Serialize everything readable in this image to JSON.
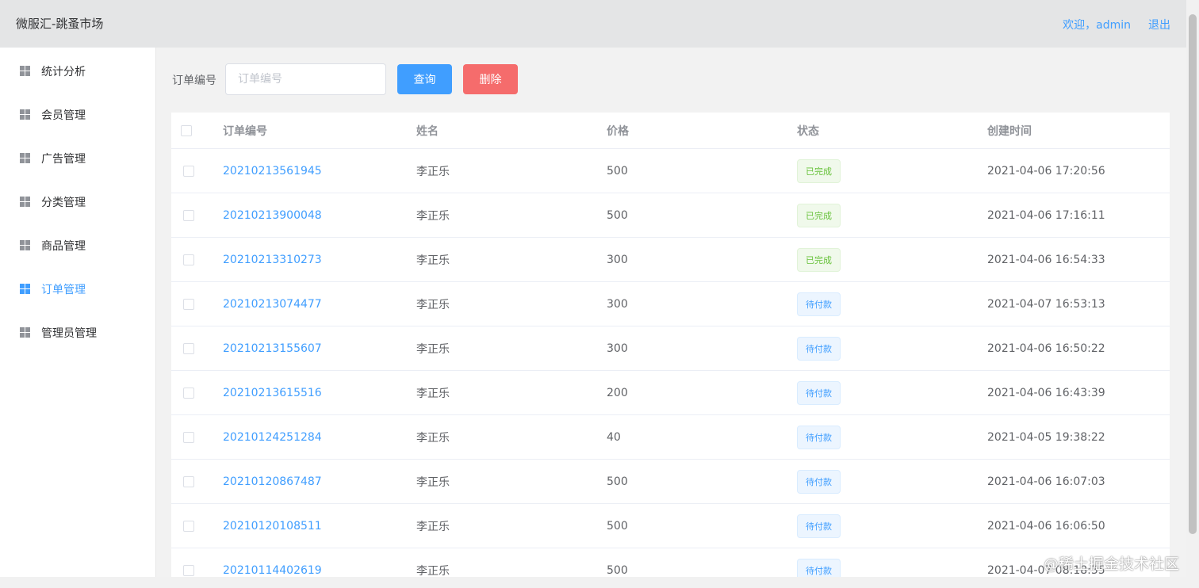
{
  "header": {
    "title": "微服汇-跳蚤市场",
    "welcome": "欢迎，admin",
    "logout": "退出"
  },
  "sidebar": {
    "items": [
      {
        "label": "统计分析",
        "icon": "grid-icon"
      },
      {
        "label": "会员管理",
        "icon": "grid-icon"
      },
      {
        "label": "广告管理",
        "icon": "grid-icon"
      },
      {
        "label": "分类管理",
        "icon": "grid-icon"
      },
      {
        "label": "商品管理",
        "icon": "grid-icon"
      },
      {
        "label": "订单管理",
        "icon": "grid-icon",
        "active": true
      },
      {
        "label": "管理员管理",
        "icon": "grid-icon"
      }
    ]
  },
  "search": {
    "label": "订单编号",
    "placeholder": "订单编号",
    "value": "",
    "query_button": "查询",
    "delete_button": "删除"
  },
  "table": {
    "headers": [
      "订单编号",
      "姓名",
      "价格",
      "状态",
      "创建时间"
    ],
    "rows": [
      {
        "order_no": "20210213561945",
        "name": "李正乐",
        "price": "500",
        "status": "已完成",
        "created": "2021-04-06 17:20:56"
      },
      {
        "order_no": "20210213900048",
        "name": "李正乐",
        "price": "500",
        "status": "已完成",
        "created": "2021-04-06 17:16:11"
      },
      {
        "order_no": "20210213310273",
        "name": "李正乐",
        "price": "300",
        "status": "已完成",
        "created": "2021-04-06 16:54:33"
      },
      {
        "order_no": "20210213074477",
        "name": "李正乐",
        "price": "300",
        "status": "待付款",
        "created": "2021-04-07 16:53:13"
      },
      {
        "order_no": "20210213155607",
        "name": "李正乐",
        "price": "300",
        "status": "待付款",
        "created": "2021-04-06 16:50:22"
      },
      {
        "order_no": "20210213615516",
        "name": "李正乐",
        "price": "200",
        "status": "待付款",
        "created": "2021-04-06 16:43:39"
      },
      {
        "order_no": "20210124251284",
        "name": "李正乐",
        "price": "40",
        "status": "待付款",
        "created": "2021-04-05 19:38:22"
      },
      {
        "order_no": "20210120867487",
        "name": "李正乐",
        "price": "500",
        "status": "待付款",
        "created": "2021-04-06 16:07:03"
      },
      {
        "order_no": "20210120108511",
        "name": "李正乐",
        "price": "500",
        "status": "待付款",
        "created": "2021-04-06 16:06:50"
      },
      {
        "order_no": "20210114402619",
        "name": "李正乐",
        "price": "500",
        "status": "待付款",
        "created": "2021-04-07 08:18:35"
      }
    ]
  },
  "watermark": "@稀土掘金技术社区",
  "colors": {
    "accent": "#409eff",
    "danger": "#f56c6c",
    "success": "#67c23a"
  }
}
